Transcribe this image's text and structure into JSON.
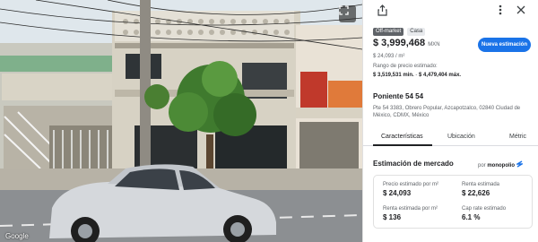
{
  "photo": {
    "watermark": "Google",
    "expand_icon": "expand-icon"
  },
  "header": {
    "share_icon": "share-icon",
    "more_icon": "more-vert-icon",
    "close_icon": "close-icon"
  },
  "listing": {
    "tags": [
      "Off-market",
      "Casa"
    ],
    "price": "$ 3,999,468",
    "currency": "MXN",
    "price_per_m2": "$ 24,093 / m²",
    "estimate_button": "Nueva estimación",
    "range_label": "Rango de precio estimado:",
    "range_min": "$ 3,519,531 min.",
    "range_sep": "-",
    "range_max": "$ 4,479,404 máx.",
    "street": "Poniente 54 54",
    "address": "Pte 54 3383, Obrero Popular, Azcapotzalco, 02840 Ciudad de México, CDMX, México"
  },
  "tabs": [
    "Características",
    "Ubicación",
    "Métric"
  ],
  "market": {
    "title": "Estimación de mercado",
    "by_label": "por",
    "brand": "monopolio",
    "brand_icon": "monopolio-logo-icon",
    "stats": [
      {
        "label": "Precio estimado por m²",
        "value": "$ 24,093"
      },
      {
        "label": "Renta estimada",
        "value": "$ 22,626"
      },
      {
        "label": "Renta estimada por m²",
        "value": "$ 136"
      },
      {
        "label": "Cap rate estimado",
        "value": "6.1 %"
      }
    ]
  },
  "colors": {
    "accent": "#1a73e8",
    "tag_dark": "#5f6368",
    "facade_blue": "#bcd3e6",
    "car_silver": "#d5d8dc"
  }
}
